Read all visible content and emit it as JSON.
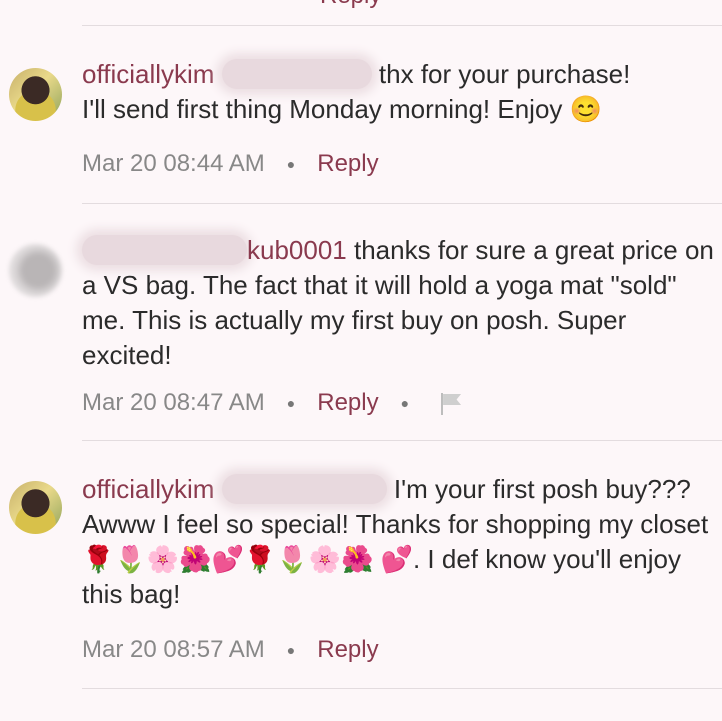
{
  "top": {
    "reply_label": "Reply"
  },
  "comments": [
    {
      "username": "officiallykim",
      "body_line1": "thx for your purchase!",
      "body_line2": "I'll send first thing Monday morning! Enjoy",
      "emoji": "😊",
      "timestamp": "Mar 20 08:44 AM",
      "reply_label": "Reply",
      "avatar_icon": "profile-photo-kim"
    },
    {
      "username_suffix": "kub0001",
      "body": "thanks for sure a great price on a VS bag. The fact that it will hold a yoga mat \"sold\" me. This is actually my first buy on posh. Super excited!",
      "timestamp": "Mar 20 08:47 AM",
      "reply_label": "Reply",
      "avatar_icon": "blurred-avatar",
      "report_icon": "flag-icon"
    },
    {
      "username": "officiallykim",
      "body_part1": "I'm your first posh buy??? Awww I feel so special! Thanks for shopping my closet",
      "emoji_row1": "🌹🌷🌸🌺💕🌹🌷🌸🌺",
      "emoji_row2": "💕",
      "body_part2": ". I def know you'll enjoy this bag!",
      "timestamp": "Mar 20 08:57 AM",
      "reply_label": "Reply",
      "avatar_icon": "profile-photo-kim"
    }
  ],
  "colors": {
    "username": "#8a3a4e",
    "background": "#fdf7f9",
    "divider": "#e3dcdf",
    "meta": "#888888"
  }
}
